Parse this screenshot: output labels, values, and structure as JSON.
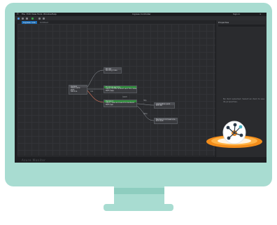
{
  "menu": {
    "items": [
      "File",
      "Edit",
      "View",
      "Tools",
      "Window",
      "Help"
    ]
  },
  "titlebar": {
    "title": "Ingress Controller",
    "right": "Sign in"
  },
  "tabs": [
    {
      "label": "Ingress rule"
    },
    {
      "label": "Untitled"
    }
  ],
  "panel": {
    "title": "Properties",
    "empty_text": "No item selected. Select an item to see its properties."
  },
  "status": {
    "logo": "Azure Monitor"
  },
  "nodes": [
    {
      "title": "Ingress",
      "rows": [
        "Host name",
        "Path",
        "Service"
      ]
    },
    {
      "title": "Router",
      "rows": [
        "Routing rules"
      ]
    },
    {
      "title": "Frontend service",
      "rows": [
        "Apply HTTPS redirect and TLS rules",
        "Path /app"
      ]
    },
    {
      "title": "Backend",
      "rows": [
        "Apply rules and send to backend",
        "Path /api"
      ]
    },
    {
      "title": "Application pool",
      "rows": [
        "Port 80"
      ]
    },
    {
      "title": "Backend microservice",
      "rows": [
        "Port 443"
      ]
    }
  ],
  "edges": {
    "label_a": "rule",
    "label_b": "match",
    "label_c": "http",
    "label_d": "https"
  },
  "icons": [
    "menu-icon",
    "save-icon",
    "undo-icon",
    "redo-icon",
    "run-icon",
    "search-icon",
    "close-icon",
    "logo-badge-icon"
  ],
  "colors": {
    "monitor": "#a8dcd1",
    "screen": "#26272a",
    "accent": "#2e8b3a",
    "tab_accent": "#1e6fb8",
    "badge_ring": "#f28c1a"
  }
}
